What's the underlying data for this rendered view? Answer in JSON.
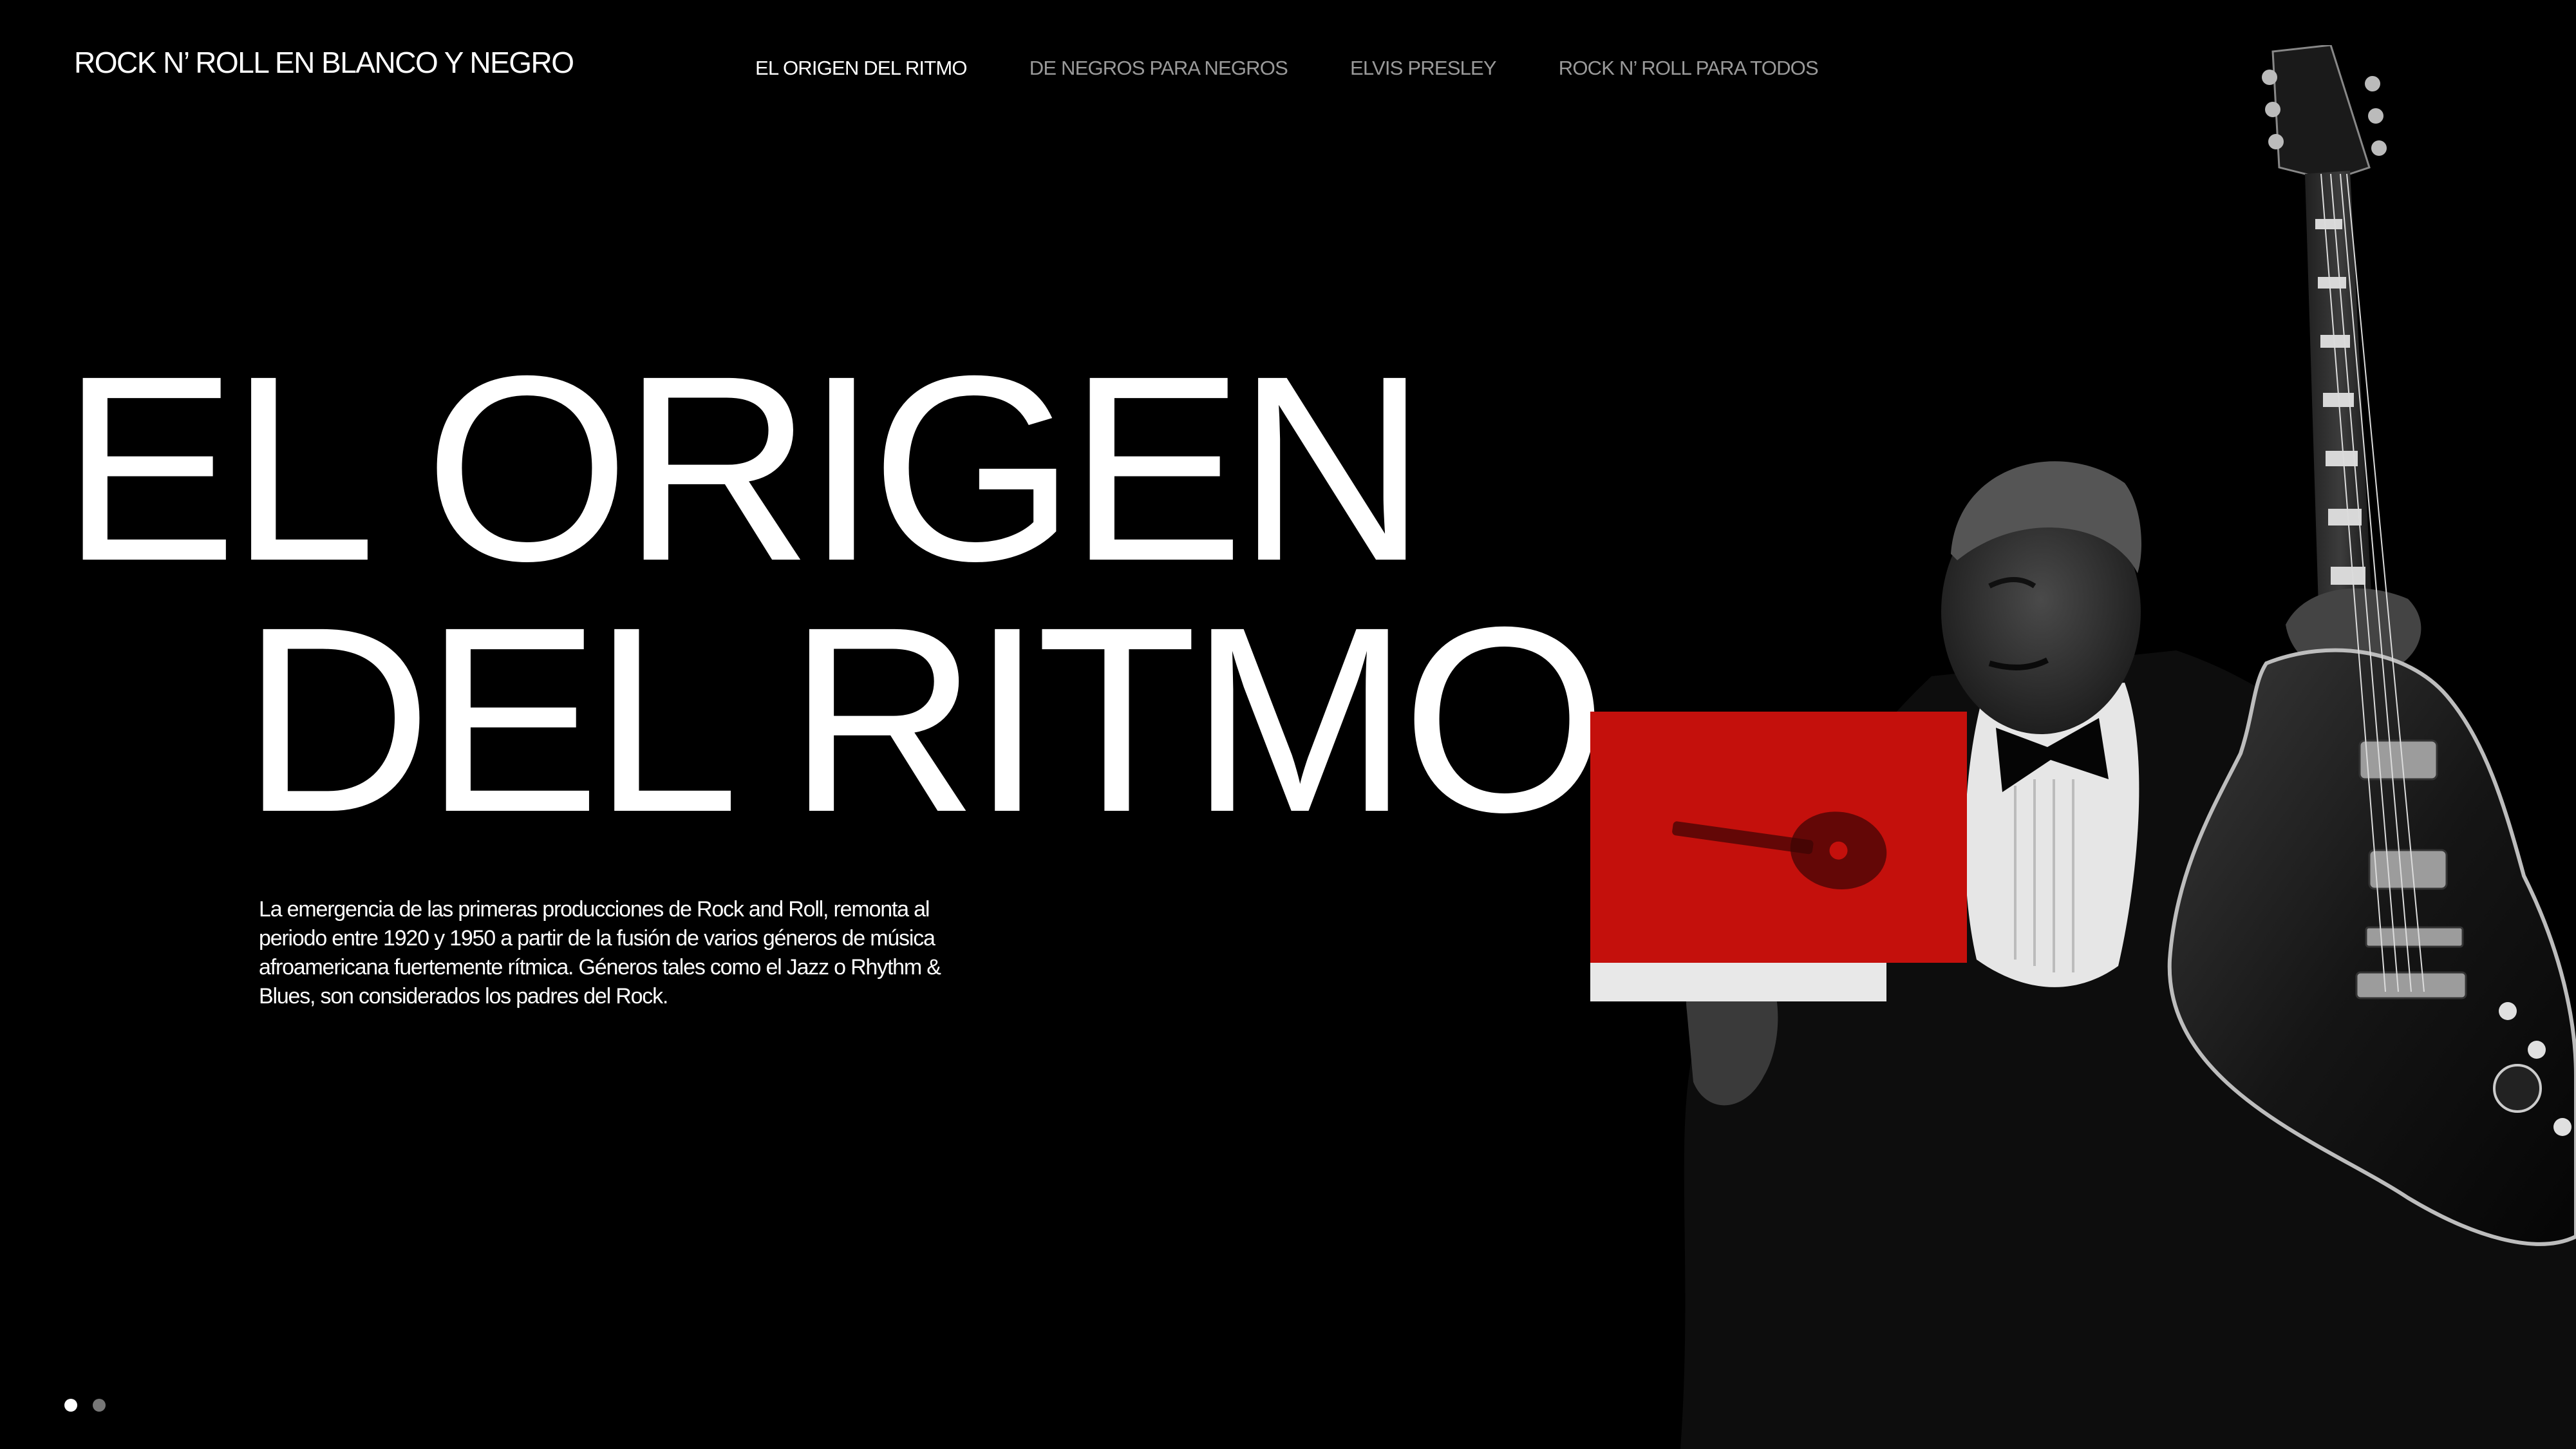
{
  "site": {
    "title": "ROCK N’ ROLL EN BLANCO Y NEGRO"
  },
  "nav": {
    "items": [
      {
        "label": "EL ORIGEN DEL RITMO",
        "active": true
      },
      {
        "label": "DE NEGROS PARA NEGROS",
        "active": false
      },
      {
        "label": "ELVIS PRESLEY",
        "active": false
      },
      {
        "label": "ROCK N’ ROLL PARA TODOS",
        "active": false
      }
    ]
  },
  "hero": {
    "line1": "EL ORIGEN",
    "line2": "DEL RITMO",
    "intro": "La emergencia de las primeras producciones de Rock and Roll, remonta al periodo entre 1920 y 1950 a partir de la fusión de varios géneros de música afroamericana fuertemente rítmica. Géneros tales como el Jazz o Rhythm & Blues, son considerados los padres del Rock."
  },
  "colors": {
    "background": "#000000",
    "text": "#ffffff",
    "nav_inactive": "#9a9a9a",
    "accent_red": "#c4100c"
  },
  "pager": {
    "count": 2,
    "active_index": 0
  }
}
